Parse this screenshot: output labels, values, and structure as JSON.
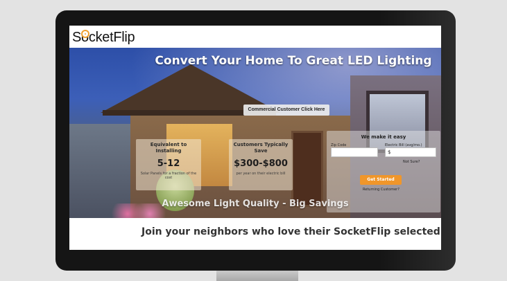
{
  "site": {
    "logo_text": "SocketFlip",
    "logo_accent_color": "#f0a030"
  },
  "hero": {
    "title": "Convert Your Home To Great LED Lighting",
    "commercial_button": "Commercial Customer Click Here",
    "tagline": "Awesome Light Quality - Big Savings"
  },
  "stats": [
    {
      "label": "Equivalent to Installing",
      "value": "5-12",
      "note": "Solar Panels for a fraction of the cost"
    },
    {
      "label": "Customers Typically Save",
      "value": "$300-$800",
      "note": "per year on their electric bill"
    }
  ],
  "form": {
    "title": "We make it easy",
    "zip_label": "Zip Code",
    "bill_label": "Electric Bill (avg/mo.)",
    "zip_value": "",
    "bill_value": "$",
    "help_link": "Not Sure?",
    "submit_label": "Get Started",
    "returning_link": "Returning Customer?",
    "submit_color": "#f0962a"
  },
  "footer": {
    "text": "Join your neighbors who love their SocketFlip selected LEDs"
  }
}
